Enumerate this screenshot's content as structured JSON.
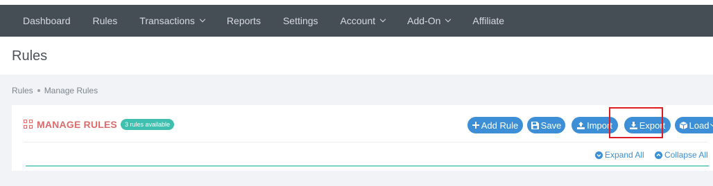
{
  "navbar": {
    "items": [
      {
        "label": "Dashboard",
        "has_dropdown": false
      },
      {
        "label": "Rules",
        "has_dropdown": false
      },
      {
        "label": "Transactions",
        "has_dropdown": true
      },
      {
        "label": "Reports",
        "has_dropdown": false
      },
      {
        "label": "Settings",
        "has_dropdown": false
      },
      {
        "label": "Account",
        "has_dropdown": true
      },
      {
        "label": "Add-On",
        "has_dropdown": true
      },
      {
        "label": "Affiliate",
        "has_dropdown": false
      }
    ]
  },
  "page": {
    "title": "Rules"
  },
  "breadcrumb": {
    "items": [
      "Rules",
      "Manage Rules"
    ]
  },
  "manage_rules": {
    "title": "MANAGE RULES",
    "badge": "3 rules available",
    "buttons": {
      "add_rule": "Add Rule",
      "save": "Save",
      "import": "Import",
      "export": "Export",
      "load": "Load"
    },
    "expand_all": "Expand All",
    "collapse_all": "Collapse All"
  },
  "colors": {
    "navbar_bg": "#454d55",
    "accent_blue": "#3c8fd6",
    "title_red": "#dd6b6b",
    "badge_teal": "#3fbfae",
    "highlight_red": "#e01b24"
  },
  "icons": {
    "add_rule": "plus-icon",
    "save": "floppy-disk-icon",
    "import": "upload-icon",
    "export": "download-icon",
    "load": "cube-icon",
    "expand_all": "chevron-down-circle-icon",
    "collapse_all": "chevron-up-circle-icon",
    "manage_rules": "grid-icon"
  }
}
